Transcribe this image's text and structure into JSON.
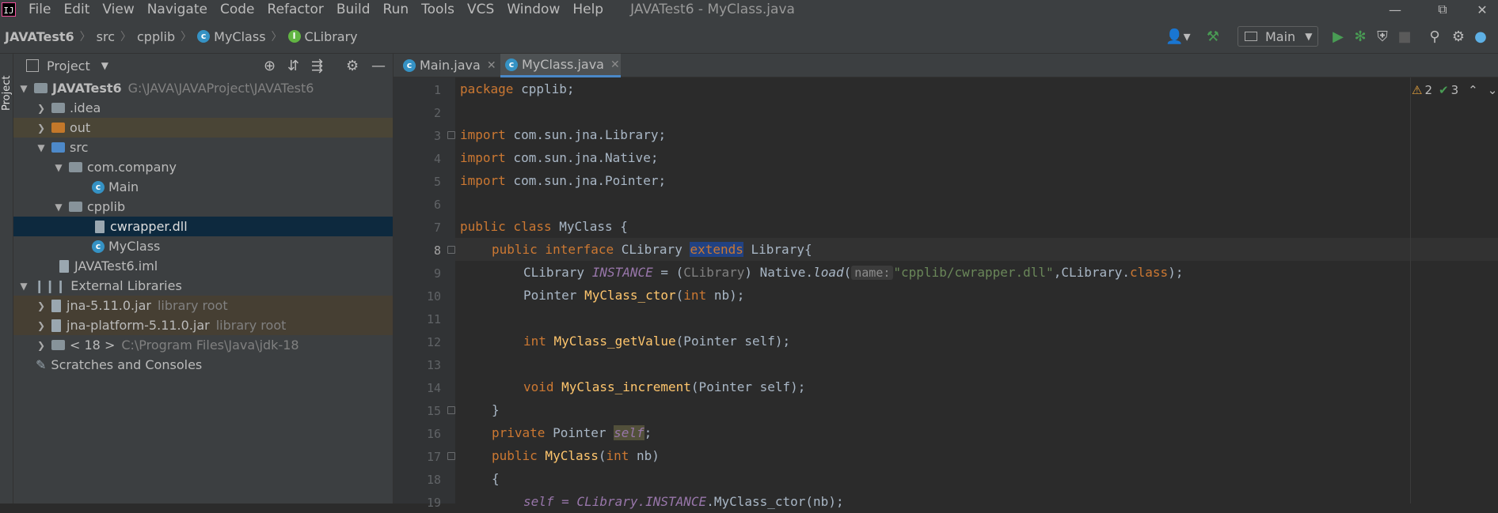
{
  "menubar": {
    "logo": "IJ",
    "items": [
      "File",
      "Edit",
      "View",
      "Navigate",
      "Code",
      "Refactor",
      "Build",
      "Run",
      "Tools",
      "VCS",
      "Window",
      "Help"
    ],
    "window_title": "JAVATest6 - MyClass.java"
  },
  "breadcrumbs": {
    "project": "JAVATest6",
    "src": "src",
    "pkg": "cpplib",
    "cls": "MyClass",
    "iface": "CLibrary"
  },
  "toolbar": {
    "run_config": "Main"
  },
  "left_strip": {
    "label": "Project"
  },
  "project_panel": {
    "title": "Project",
    "rows": [
      {
        "name": "JAVATest6",
        "path": "G:\\JAVA\\JAVAProject\\JAVATest6"
      },
      {
        "name": ".idea"
      },
      {
        "name": "out"
      },
      {
        "name": "src"
      },
      {
        "name": "com.company"
      },
      {
        "name": "Main"
      },
      {
        "name": "cpplib"
      },
      {
        "name": "cwrapper.dll"
      },
      {
        "name": "MyClass"
      },
      {
        "name": "JAVATest6.iml"
      },
      {
        "name": "External Libraries"
      },
      {
        "name": "jna-5.11.0.jar",
        "note": "library root"
      },
      {
        "name": "jna-platform-5.11.0.jar",
        "note": "library root"
      },
      {
        "name": "< 18 >",
        "note": "C:\\Program Files\\Java\\jdk-18"
      },
      {
        "name": "Scratches and Consoles"
      }
    ]
  },
  "tabs": [
    {
      "label": "Main.java"
    },
    {
      "label": "MyClass.java"
    }
  ],
  "inspection": {
    "warnings": "2",
    "checks": "3"
  },
  "line_numbers": [
    "1",
    "2",
    "3",
    "4",
    "5",
    "6",
    "7",
    "8",
    "9",
    "10",
    "11",
    "12",
    "13",
    "14",
    "15",
    "16",
    "17",
    "18",
    "19"
  ],
  "code": {
    "l1_kw": "package",
    "l1_rest": " cpplib;",
    "l3_kw": "import",
    "l3_rest": " com.sun.jna.Library;",
    "l4_kw": "import",
    "l4_rest": " com.sun.jna.Native;",
    "l5_kw": "import",
    "l5_rest": " com.sun.jna.Pointer;",
    "l7_kw": "public class",
    "l7_rest": " MyClass {",
    "l8_kw": "public interface",
    "l8_name": " CLibrary ",
    "l8_ext": "extends",
    "l8_rest": " Library{",
    "l9_a": "CLibrary ",
    "l9_inst": "INSTANCE",
    "l9_b": " = (",
    "l9_cast": "CLibrary",
    "l9_c": ") Native.",
    "l9_load": "load",
    "l9_d": "(",
    "l9_hint": "name:",
    "l9_str": "\"cpplib/cwrapper.dll\"",
    "l9_e": ",CLibrary.",
    "l9_class": "class",
    "l9_f": ");",
    "l10_a": "Pointer ",
    "l10_fn": "MyClass_ctor",
    "l10_b": "(",
    "l10_kw": "int",
    "l10_c": " nb);",
    "l12_kw": "int",
    "l12_fn": " MyClass_getValue",
    "l12_rest": "(Pointer self);",
    "l14_kw": "void",
    "l14_fn": " MyClass_increment",
    "l14_rest": "(Pointer self);",
    "l15": "}",
    "l16_kw": "private",
    "l16_a": " Pointer ",
    "l16_self": "self",
    "l16_b": ";",
    "l17_kw": "public",
    "l17_fn": " MyClass",
    "l17_a": "(",
    "l17_kw2": "int",
    "l17_b": " nb)",
    "l18": "{",
    "l19_a": "self = CLibrary.",
    "l19_inst": "INSTANCE",
    "l19_b": ".MyClass_ctor(nb);"
  },
  "colors": {
    "accent": "#4a88c7",
    "keyword": "#cc7832",
    "function": "#ffc66d",
    "string": "#6a8759",
    "selection": "#0d293e"
  }
}
